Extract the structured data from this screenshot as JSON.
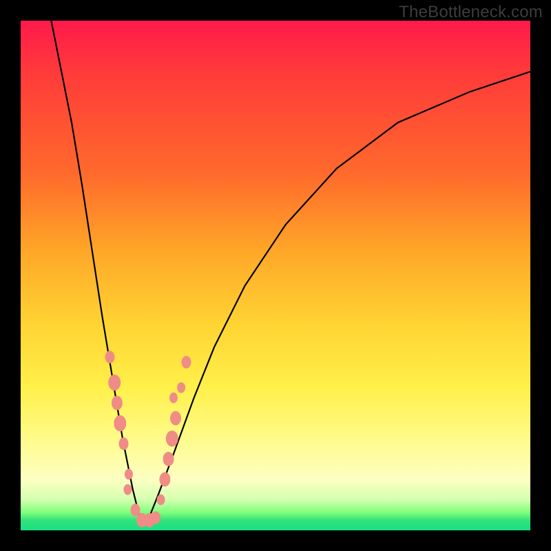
{
  "watermark": "TheBottleneck.com",
  "colors": {
    "frame": "#000000",
    "curve": "#000000",
    "marker": "#f08c86",
    "gradient_top": "#ff1a4b",
    "gradient_bottom": "#1adf84"
  },
  "chart_data": {
    "type": "line",
    "title": "",
    "xlabel": "",
    "ylabel": "",
    "xlim": [
      0,
      100
    ],
    "ylim": [
      0,
      100
    ],
    "note": "No axis ticks or numeric labels are visible in the image; x and y are in chart-percent coordinates. Curve is a V-shaped bottleneck curve with minimum near x≈24. Values are estimated from pixel positions.",
    "series": [
      {
        "name": "bottleneck-curve",
        "x": [
          6,
          8,
          10,
          12,
          14,
          16,
          18,
          20,
          22,
          23.5,
          25,
          27,
          30,
          34,
          38,
          44,
          52,
          62,
          74,
          88,
          100
        ],
        "y": [
          100,
          90,
          80,
          68,
          55,
          42,
          30,
          18,
          8,
          2,
          2,
          7,
          15,
          26,
          36,
          48,
          60,
          71,
          80,
          86,
          90
        ]
      }
    ],
    "markers": {
      "name": "highlight-points",
      "note": "Salmon-colored dots clustered on both sides of the V near the bottom.",
      "points": [
        {
          "x": 17.5,
          "y": 34,
          "r": 7
        },
        {
          "x": 18.4,
          "y": 29,
          "r": 9
        },
        {
          "x": 18.9,
          "y": 25,
          "r": 8
        },
        {
          "x": 19.5,
          "y": 21,
          "r": 9
        },
        {
          "x": 20.2,
          "y": 17,
          "r": 7
        },
        {
          "x": 21.2,
          "y": 11,
          "r": 6
        },
        {
          "x": 21.0,
          "y": 8,
          "r": 6
        },
        {
          "x": 22.5,
          "y": 4,
          "r": 7
        },
        {
          "x": 23.8,
          "y": 2,
          "r": 8
        },
        {
          "x": 25.3,
          "y": 2,
          "r": 8
        },
        {
          "x": 26.5,
          "y": 2.5,
          "r": 7
        },
        {
          "x": 27.5,
          "y": 6,
          "r": 6
        },
        {
          "x": 28.3,
          "y": 10,
          "r": 8
        },
        {
          "x": 29.0,
          "y": 14,
          "r": 8
        },
        {
          "x": 29.7,
          "y": 18,
          "r": 9
        },
        {
          "x": 30.4,
          "y": 22,
          "r": 8
        },
        {
          "x": 30.0,
          "y": 26,
          "r": 6
        },
        {
          "x": 31.5,
          "y": 28,
          "r": 6
        },
        {
          "x": 32.5,
          "y": 33,
          "r": 7
        }
      ]
    }
  }
}
